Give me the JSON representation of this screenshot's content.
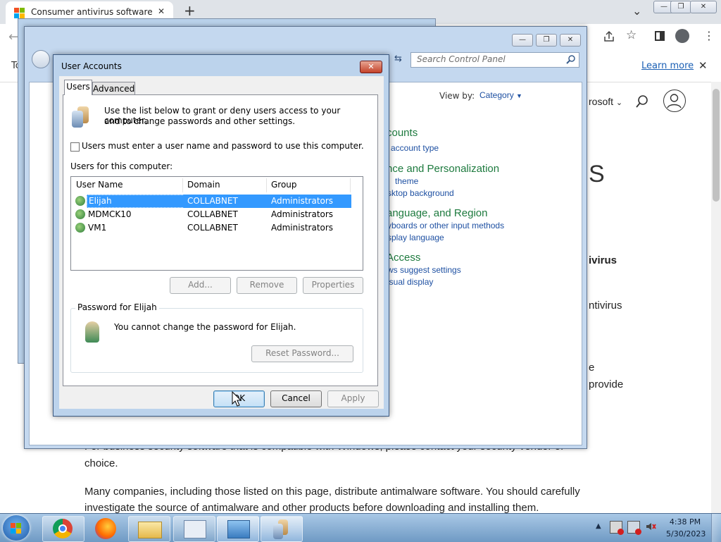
{
  "browser": {
    "tab_title": "Consumer antivirus software pro",
    "tab_close": "✕",
    "new_tab": "+",
    "infobar_prefix": "To",
    "learn_more": "Learn more",
    "infobar_close": "✕",
    "window_min": "—",
    "window_max": "❐",
    "window_close": "✕",
    "menu_dots": "⋮",
    "dropdown": "⌄"
  },
  "page": {
    "nav_microsoft": "rosoft",
    "heading_fragment": "S",
    "text_virus": "ivirus",
    "text_tivirus": "ntivirus",
    "text_e": "e",
    "text_provide": "provide",
    "para1_line1": "For business security software that is compatible with Windows, please contact your security vendor of",
    "para1_line2": "choice.",
    "para2_line1": "Many companies, including those listed on this page, distribute antimalware software. You should carefully",
    "para2_line2": "investigate the source of antimalware and other products before downloading and installing them."
  },
  "control_panel": {
    "search_placeholder": "Search Control Panel",
    "view_by_label": "View by:",
    "view_by_value": "Category",
    "sections": [
      {
        "heading": "counts",
        "links": [
          "account type"
        ]
      },
      {
        "heading": "nce and Personalization",
        "links": [
          "theme",
          "sktop background"
        ]
      },
      {
        "heading": "anguage, and Region",
        "links": [
          "yboards or other input methods",
          "splay language"
        ]
      },
      {
        "heading": "Access",
        "links": [
          "ws suggest settings",
          "isual display"
        ]
      }
    ]
  },
  "user_accounts": {
    "title": "User Accounts",
    "close": "✕",
    "tabs": [
      "Users",
      "Advanced"
    ],
    "intro_line1": "Use the list below to grant or deny users access to your computer,",
    "intro_line2": "and to change passwords and other settings.",
    "checkbox_label": "Users must enter a user name and password to use this computer.",
    "checkbox_checked": false,
    "list_label": "Users for this computer:",
    "columns": [
      "User Name",
      "Domain",
      "Group"
    ],
    "rows": [
      {
        "name": "Elijah",
        "domain": "COLLABNET",
        "group": "Administrators",
        "selected": true
      },
      {
        "name": "MDMCK10",
        "domain": "COLLABNET",
        "group": "Administrators",
        "selected": false
      },
      {
        "name": "VM1",
        "domain": "COLLABNET",
        "group": "Administrators",
        "selected": false
      }
    ],
    "buttons": {
      "add": "Add...",
      "remove": "Remove",
      "properties": "Properties"
    },
    "password_group_title": "Password for Elijah",
    "password_message": "You cannot change the password for Elijah.",
    "reset_password": "Reset Password...",
    "ok": "OK",
    "cancel": "Cancel",
    "apply": "Apply"
  },
  "taskbar": {
    "time": "4:38 PM",
    "date": "5/30/2023",
    "tray_arrow": "▲"
  }
}
